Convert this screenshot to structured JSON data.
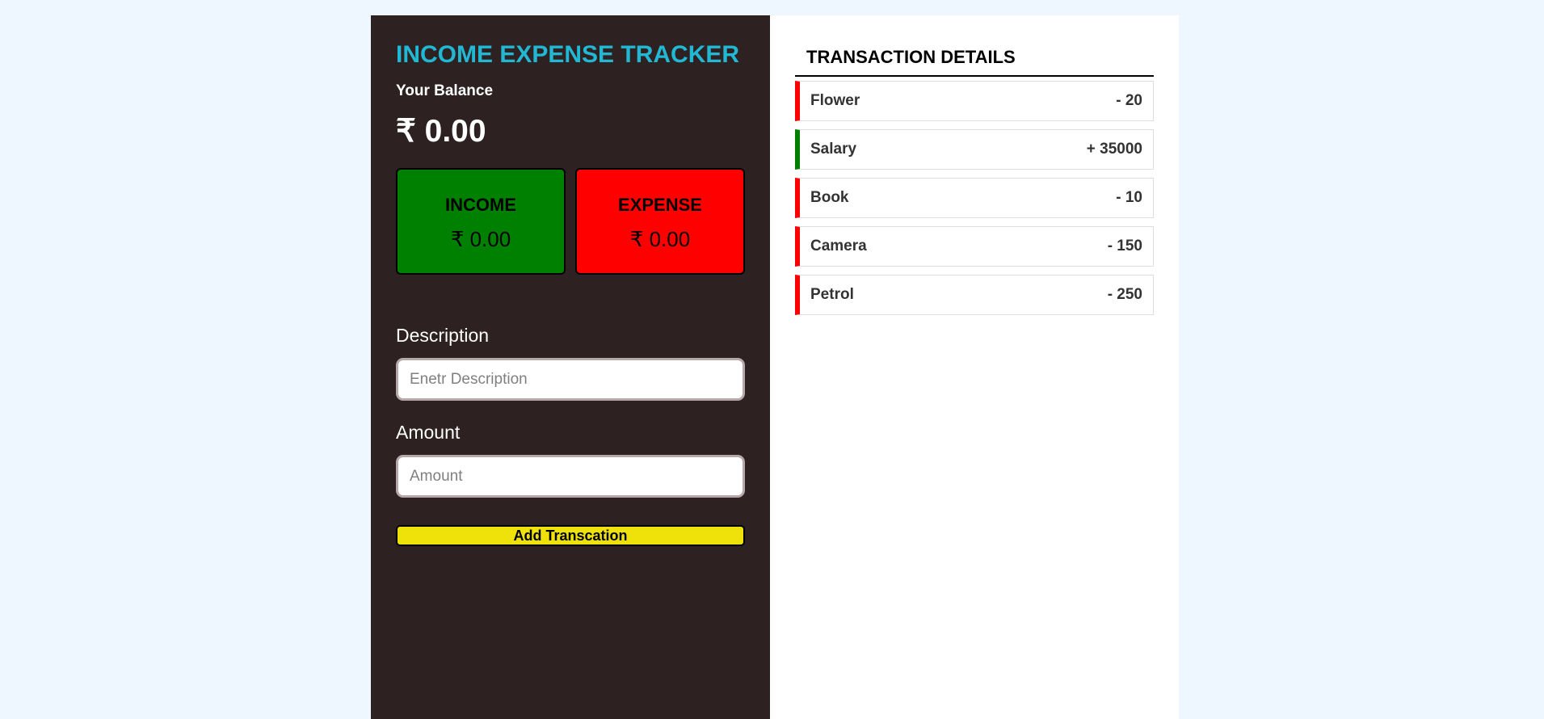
{
  "app": {
    "title": "INCOME EXPENSE TRACKER"
  },
  "balance": {
    "label": "Your Balance",
    "value": "₹ 0.00"
  },
  "income": {
    "label": "INCOME",
    "value": "₹ 0.00"
  },
  "expense": {
    "label": "EXPENSE",
    "value": "₹ 0.00"
  },
  "form": {
    "description_label": "Description",
    "description_placeholder": "Enetr Description",
    "description_value": "",
    "amount_label": "Amount",
    "amount_placeholder": "Amount",
    "amount_value": "",
    "submit_label": "Add Transcation"
  },
  "details": {
    "title": "TRANSACTION DETAILS",
    "transactions": [
      {
        "name": "Flower",
        "amount": "- 20",
        "type": "expense"
      },
      {
        "name": "Salary",
        "amount": "+ 35000",
        "type": "income"
      },
      {
        "name": "Book",
        "amount": "- 10",
        "type": "expense"
      },
      {
        "name": "Camera",
        "amount": "- 150",
        "type": "expense"
      },
      {
        "name": "Petrol",
        "amount": "- 250",
        "type": "expense"
      }
    ]
  },
  "colors": {
    "page_background": "#eef6ff",
    "panel_dark": "#2d2121",
    "title_accent": "#22b8d4",
    "income": "#008000",
    "expense": "#ff0000",
    "button": "#eee20a"
  }
}
